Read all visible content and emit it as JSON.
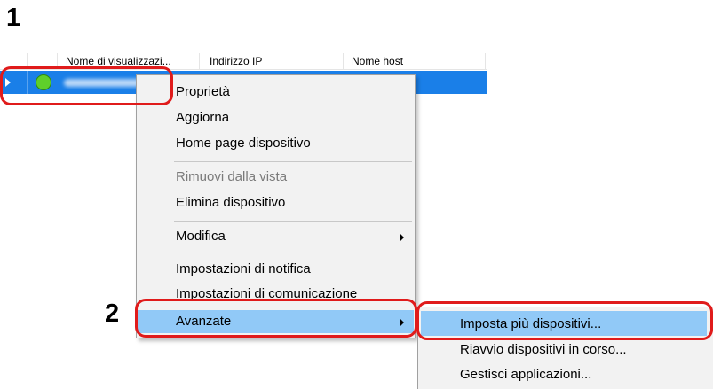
{
  "steps": {
    "step1": "1",
    "step2": "2"
  },
  "device_list": {
    "columns": [
      "Nome di visualizzazi...",
      "Indirizzo IP",
      "Nome host"
    ]
  },
  "context_menu": {
    "items": [
      {
        "label": "Proprietà",
        "disabled": false
      },
      {
        "label": "Aggiorna",
        "disabled": false
      },
      {
        "label": "Home page dispositivo",
        "disabled": false
      },
      {
        "label": "Rimuovi dalla vista",
        "disabled": true
      },
      {
        "label": "Elimina dispositivo",
        "disabled": false
      },
      {
        "label": "Modifica",
        "disabled": false,
        "submenu": true
      },
      {
        "label": "Impostazioni di notifica",
        "disabled": false
      },
      {
        "label": "Impostazioni di comunicazione",
        "disabled": false
      },
      {
        "label": "Avanzate",
        "disabled": false,
        "submenu": true,
        "highlighted": true
      }
    ]
  },
  "submenu": {
    "items": [
      {
        "label": "Imposta più dispositivi...",
        "highlighted": true
      },
      {
        "label": "Riavvio dispositivi in corso..."
      },
      {
        "label": "Gestisci applicazioni..."
      }
    ]
  },
  "colors": {
    "selection": "#1a7fe8",
    "menu_highlight": "#91c9f7",
    "callout": "#e01b1b",
    "status_ok": "#5fcf2a"
  }
}
